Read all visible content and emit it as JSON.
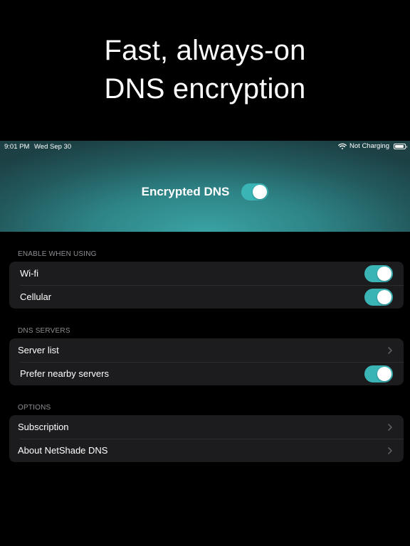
{
  "promo": {
    "line1": "Fast, always-on",
    "line2": "DNS encryption"
  },
  "statusbar": {
    "time": "9:01 PM",
    "date": "Wed Sep 30",
    "charging": "Not Charging",
    "wifi_icon": "wifi-icon",
    "battery_icon": "battery-icon",
    "battery_level": 0.95
  },
  "hero": {
    "label": "Encrypted DNS",
    "toggle_on": true,
    "accent": "#3bb4b6"
  },
  "sections": {
    "enable_when_using": {
      "header": "ENABLE WHEN USING",
      "rows": [
        {
          "label": "Wi-fi",
          "toggle_on": true
        },
        {
          "label": "Cellular",
          "toggle_on": true
        }
      ]
    },
    "dns_servers": {
      "header": "DNS SERVERS",
      "rows": [
        {
          "label": "Server list",
          "chevron": "chevron-right-icon"
        },
        {
          "label": "Prefer nearby servers",
          "toggle_on": true
        }
      ]
    },
    "options": {
      "header": "OPTIONS",
      "rows": [
        {
          "label": "Subscription",
          "chevron": "chevron-right-icon"
        },
        {
          "label": "About NetShade DNS",
          "chevron": "chevron-right-icon"
        }
      ]
    }
  }
}
